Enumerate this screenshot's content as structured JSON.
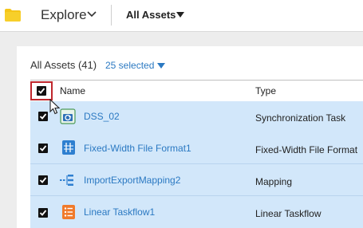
{
  "topbar": {
    "explore_label": "Explore",
    "assets_label": "All Assets"
  },
  "list": {
    "count_label": "All Assets (41)",
    "selected_label": "25 selected",
    "columns": {
      "name": "Name",
      "type": "Type"
    },
    "header_checked": true,
    "rows": [
      {
        "name": "DSS_02",
        "type": "Synchronization Task",
        "icon": "sync-task-icon",
        "checked": true
      },
      {
        "name": "Fixed-Width File Format1",
        "type": "Fixed-Width File Format",
        "icon": "fixed-width-icon",
        "checked": true
      },
      {
        "name": "ImportExportMapping2",
        "type": "Mapping",
        "icon": "mapping-icon",
        "checked": true
      },
      {
        "name": "Linear Taskflow1",
        "type": "Linear Taskflow",
        "icon": "linear-taskflow-icon",
        "checked": true
      }
    ]
  },
  "colors": {
    "link": "#2b79c2",
    "row_selected": "#d2e7fa",
    "highlight": "#c0272d",
    "folder": "#f5c518"
  }
}
